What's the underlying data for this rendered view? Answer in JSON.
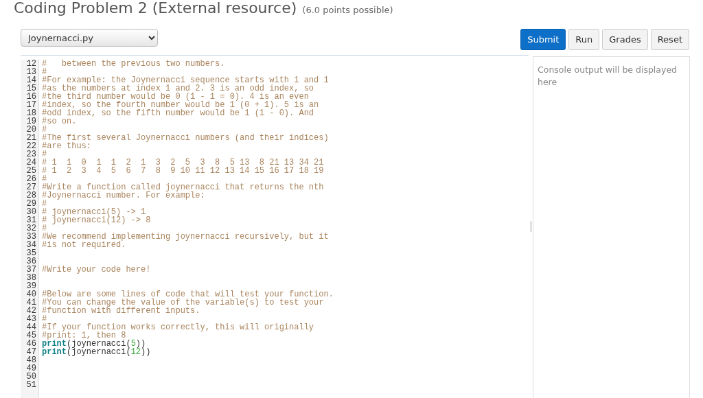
{
  "title": "Coding Problem 2 (External resource)",
  "points": "(6.0 points possible)",
  "file_select": {
    "value": "Joynernacci.py"
  },
  "buttons": [
    {
      "label": "Submit",
      "kind": "primary"
    },
    {
      "label": "Run",
      "kind": "secondary"
    },
    {
      "label": "Grades",
      "kind": "secondary"
    },
    {
      "label": "Reset",
      "kind": "secondary"
    }
  ],
  "code_lines": [
    {
      "number": "12",
      "tokens": [
        {
          "kind": "comment",
          "text": "#   between the previous two numbers."
        }
      ]
    },
    {
      "number": "13",
      "tokens": [
        {
          "kind": "comment",
          "text": "#"
        }
      ]
    },
    {
      "number": "14",
      "tokens": [
        {
          "kind": "comment",
          "text": "#For example: the Joynernacci sequence starts with 1 and 1"
        }
      ]
    },
    {
      "number": "15",
      "tokens": [
        {
          "kind": "comment",
          "text": "#as the numbers at index 1 and 2. 3 is an odd index, so"
        }
      ]
    },
    {
      "number": "16",
      "tokens": [
        {
          "kind": "comment",
          "text": "#the third number would be 0 (1 - 1 = 0). 4 is an even"
        }
      ]
    },
    {
      "number": "17",
      "tokens": [
        {
          "kind": "comment",
          "text": "#index, so the fourth number would be 1 (0 + 1). 5 is an"
        }
      ]
    },
    {
      "number": "18",
      "tokens": [
        {
          "kind": "comment",
          "text": "#odd index, so the fifth number would be 1 (1 - 0). And"
        }
      ]
    },
    {
      "number": "19",
      "tokens": [
        {
          "kind": "comment",
          "text": "#so on."
        }
      ]
    },
    {
      "number": "20",
      "tokens": [
        {
          "kind": "comment",
          "text": "#"
        }
      ]
    },
    {
      "number": "21",
      "tokens": [
        {
          "kind": "comment",
          "text": "#The first several Joynernacci numbers (and their indices)"
        }
      ]
    },
    {
      "number": "22",
      "tokens": [
        {
          "kind": "comment",
          "text": "#are thus:"
        }
      ]
    },
    {
      "number": "23",
      "tokens": [
        {
          "kind": "comment",
          "text": "#"
        }
      ]
    },
    {
      "number": "24",
      "tokens": [
        {
          "kind": "comment",
          "text": "# 1  1  0  1  1  2  1  3  2  5  3  8  5 13  8 21 13 34 21"
        }
      ]
    },
    {
      "number": "25",
      "tokens": [
        {
          "kind": "comment",
          "text": "# 1  2  3  4  5  6  7  8  9 10 11 12 13 14 15 16 17 18 19"
        }
      ]
    },
    {
      "number": "26",
      "tokens": [
        {
          "kind": "comment",
          "text": "#"
        }
      ]
    },
    {
      "number": "27",
      "tokens": [
        {
          "kind": "comment",
          "text": "#Write a function called joynernacci that returns the nth"
        }
      ]
    },
    {
      "number": "28",
      "tokens": [
        {
          "kind": "comment",
          "text": "#Joynernacci number. For example:"
        }
      ]
    },
    {
      "number": "29",
      "tokens": [
        {
          "kind": "comment",
          "text": "#"
        }
      ]
    },
    {
      "number": "30",
      "tokens": [
        {
          "kind": "comment",
          "text": "# joynernacci(5) -> 1"
        }
      ]
    },
    {
      "number": "31",
      "tokens": [
        {
          "kind": "comment",
          "text": "# joynernacci(12) -> 8"
        }
      ]
    },
    {
      "number": "32",
      "tokens": [
        {
          "kind": "comment",
          "text": "#"
        }
      ]
    },
    {
      "number": "33",
      "tokens": [
        {
          "kind": "comment",
          "text": "#We recommend implementing joynernacci recursively, but it"
        }
      ]
    },
    {
      "number": "34",
      "tokens": [
        {
          "kind": "comment",
          "text": "#is not required."
        }
      ]
    },
    {
      "number": "35"
    },
    {
      "number": "36"
    },
    {
      "number": "37",
      "tokens": [
        {
          "kind": "comment",
          "text": "#Write your code here!"
        }
      ]
    },
    {
      "number": "38"
    },
    {
      "number": "39"
    },
    {
      "number": "40",
      "tokens": [
        {
          "kind": "comment",
          "text": "#Below are some lines of code that will test your function."
        }
      ]
    },
    {
      "number": "41",
      "tokens": [
        {
          "kind": "comment",
          "text": "#You can change the value of the variable(s) to test your"
        }
      ]
    },
    {
      "number": "42",
      "tokens": [
        {
          "kind": "comment",
          "text": "#function with different inputs."
        }
      ]
    },
    {
      "number": "43",
      "tokens": [
        {
          "kind": "comment",
          "text": "#"
        }
      ]
    },
    {
      "number": "44",
      "tokens": [
        {
          "kind": "comment",
          "text": "#If your function works correctly, this will originally"
        }
      ]
    },
    {
      "number": "45",
      "tokens": [
        {
          "kind": "comment",
          "text": "#print: 1, then 8"
        }
      ]
    },
    {
      "number": "46",
      "tokens": [
        {
          "kind": "keyword",
          "text": "print"
        },
        {
          "kind": "plain",
          "text": "(joynernacci("
        },
        {
          "kind": "number",
          "text": "5"
        },
        {
          "kind": "plain",
          "text": "))"
        }
      ]
    },
    {
      "number": "47",
      "tokens": [
        {
          "kind": "keyword",
          "text": "print"
        },
        {
          "kind": "plain",
          "text": "(joynernacci("
        },
        {
          "kind": "number",
          "text": "12"
        },
        {
          "kind": "plain",
          "text": "))"
        }
      ]
    },
    {
      "number": "48"
    },
    {
      "number": "49"
    },
    {
      "number": "50"
    },
    {
      "number": "51"
    }
  ],
  "console": {
    "placeholder": "Console output will be displayed here"
  }
}
